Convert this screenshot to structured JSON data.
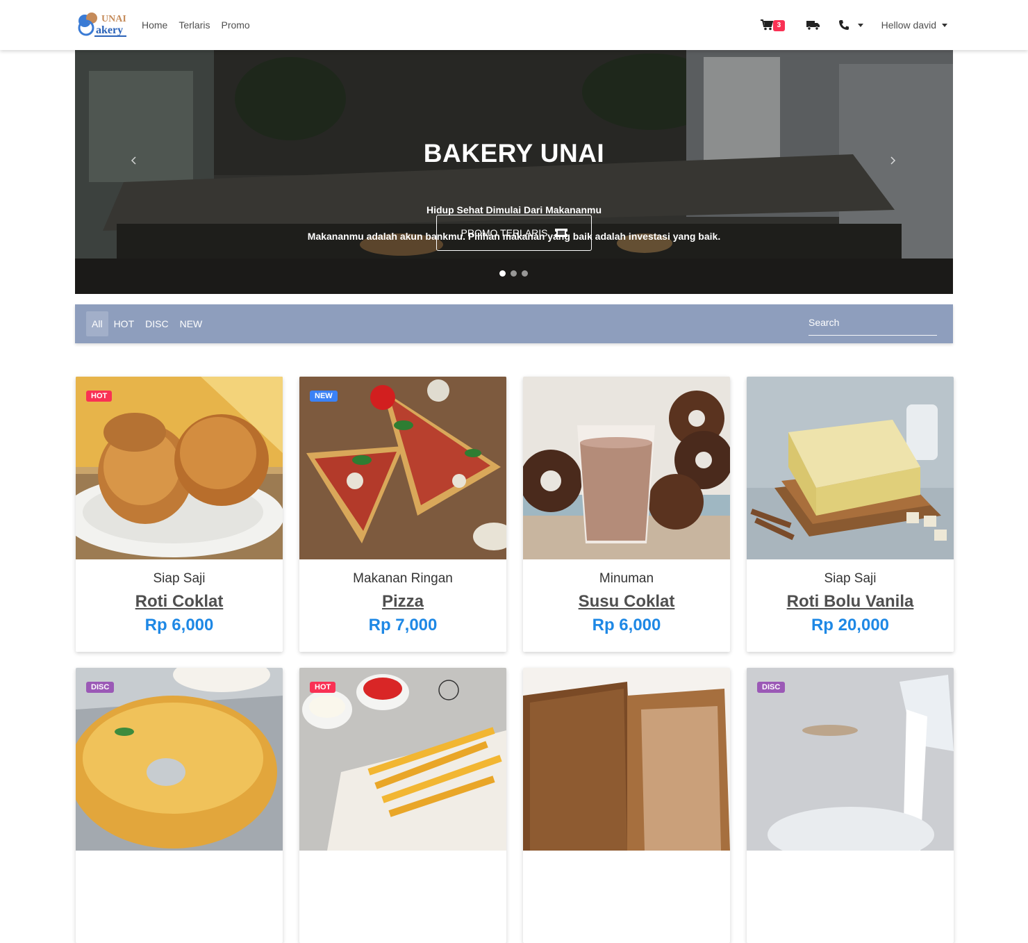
{
  "brand": {
    "logo_text_top": "UNAI",
    "logo_text_bottom": "akery"
  },
  "nav": {
    "links": [
      "Home",
      "Terlaris",
      "Promo"
    ]
  },
  "header_right": {
    "cart_count": "3",
    "user_label": "Hellow david"
  },
  "hero": {
    "title": "BAKERY UNAI",
    "subtitle": "Hidup Sehat Dimulai Dari Makananmu",
    "tagline": "Makananmu adalah akun bankmu. Pilihan makanan yang baik adalah investasi yang baik.",
    "button_label": "PROMO TERLARIS",
    "slides": 3,
    "active_slide": 1
  },
  "filter": {
    "tabs": [
      "All",
      "HOT",
      "DISC",
      "NEW"
    ],
    "active_tab": "All",
    "search_placeholder": "Search"
  },
  "products": [
    {
      "tag": "HOT",
      "category": "Siap Saji",
      "name": "Roti Coklat",
      "price": "Rp 6,000"
    },
    {
      "tag": "NEW",
      "category": "Makanan Ringan",
      "name": "Pizza",
      "price": "Rp 7,000"
    },
    {
      "tag": "",
      "category": "Minuman",
      "name": "Susu Coklat",
      "price": "Rp 6,000"
    },
    {
      "tag": "",
      "category": "Siap Saji",
      "name": "Roti Bolu Vanila",
      "price": "Rp 20,000"
    },
    {
      "tag": "DISC",
      "category": "",
      "name": "",
      "price": ""
    },
    {
      "tag": "HOT",
      "category": "",
      "name": "",
      "price": ""
    },
    {
      "tag": "",
      "category": "",
      "name": "",
      "price": ""
    },
    {
      "tag": "DISC",
      "category": "",
      "name": "",
      "price": ""
    }
  ],
  "colors": {
    "filter_bar": "#8e9ebd",
    "price": "#1e88e5",
    "tag_hot": "#f93154",
    "tag_new": "#3b82f6",
    "tag_disc": "#9b59b6",
    "cart_badge": "#f93154"
  },
  "icons": [
    "cart-icon",
    "truck-icon",
    "phone-icon",
    "ticket-icon",
    "chevron-left-icon",
    "chevron-right-icon"
  ]
}
